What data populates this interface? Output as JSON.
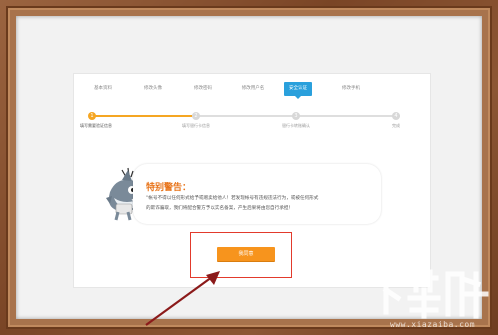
{
  "tabs": [
    {
      "label": "基本资料",
      "active": false
    },
    {
      "label": "修改头像",
      "active": false
    },
    {
      "label": "修改密码",
      "active": false
    },
    {
      "label": "修改用户名",
      "active": false
    },
    {
      "label": "安全认证",
      "active": true
    },
    {
      "label": "修改手机",
      "active": false
    }
  ],
  "steps": [
    {
      "num": "1",
      "label": "填写需要验证信息",
      "done": true
    },
    {
      "num": "2",
      "label": "填写银行卡信息",
      "done": false
    },
    {
      "num": "3",
      "label": "银行卡转账确认",
      "done": false
    },
    {
      "num": "4",
      "label": "完成",
      "done": false
    }
  ],
  "warning": {
    "title": "特别警告：",
    "line1": "“帐号不得以任何形式给予或赠卖给他人！若发现帐号有违规违法行为，或被任何形式",
    "line2": "的欺诈骗取，我们将配合警方予以实名备案，产生后果将由您自行承担！"
  },
  "button": {
    "label": "我同意"
  },
  "watermark": {
    "url": "www.xiazaiba.com"
  },
  "colors": {
    "accent": "#2aa0dc",
    "orange": "#f7941d",
    "highlight": "#e23a2c",
    "frame": "#8a5431"
  }
}
